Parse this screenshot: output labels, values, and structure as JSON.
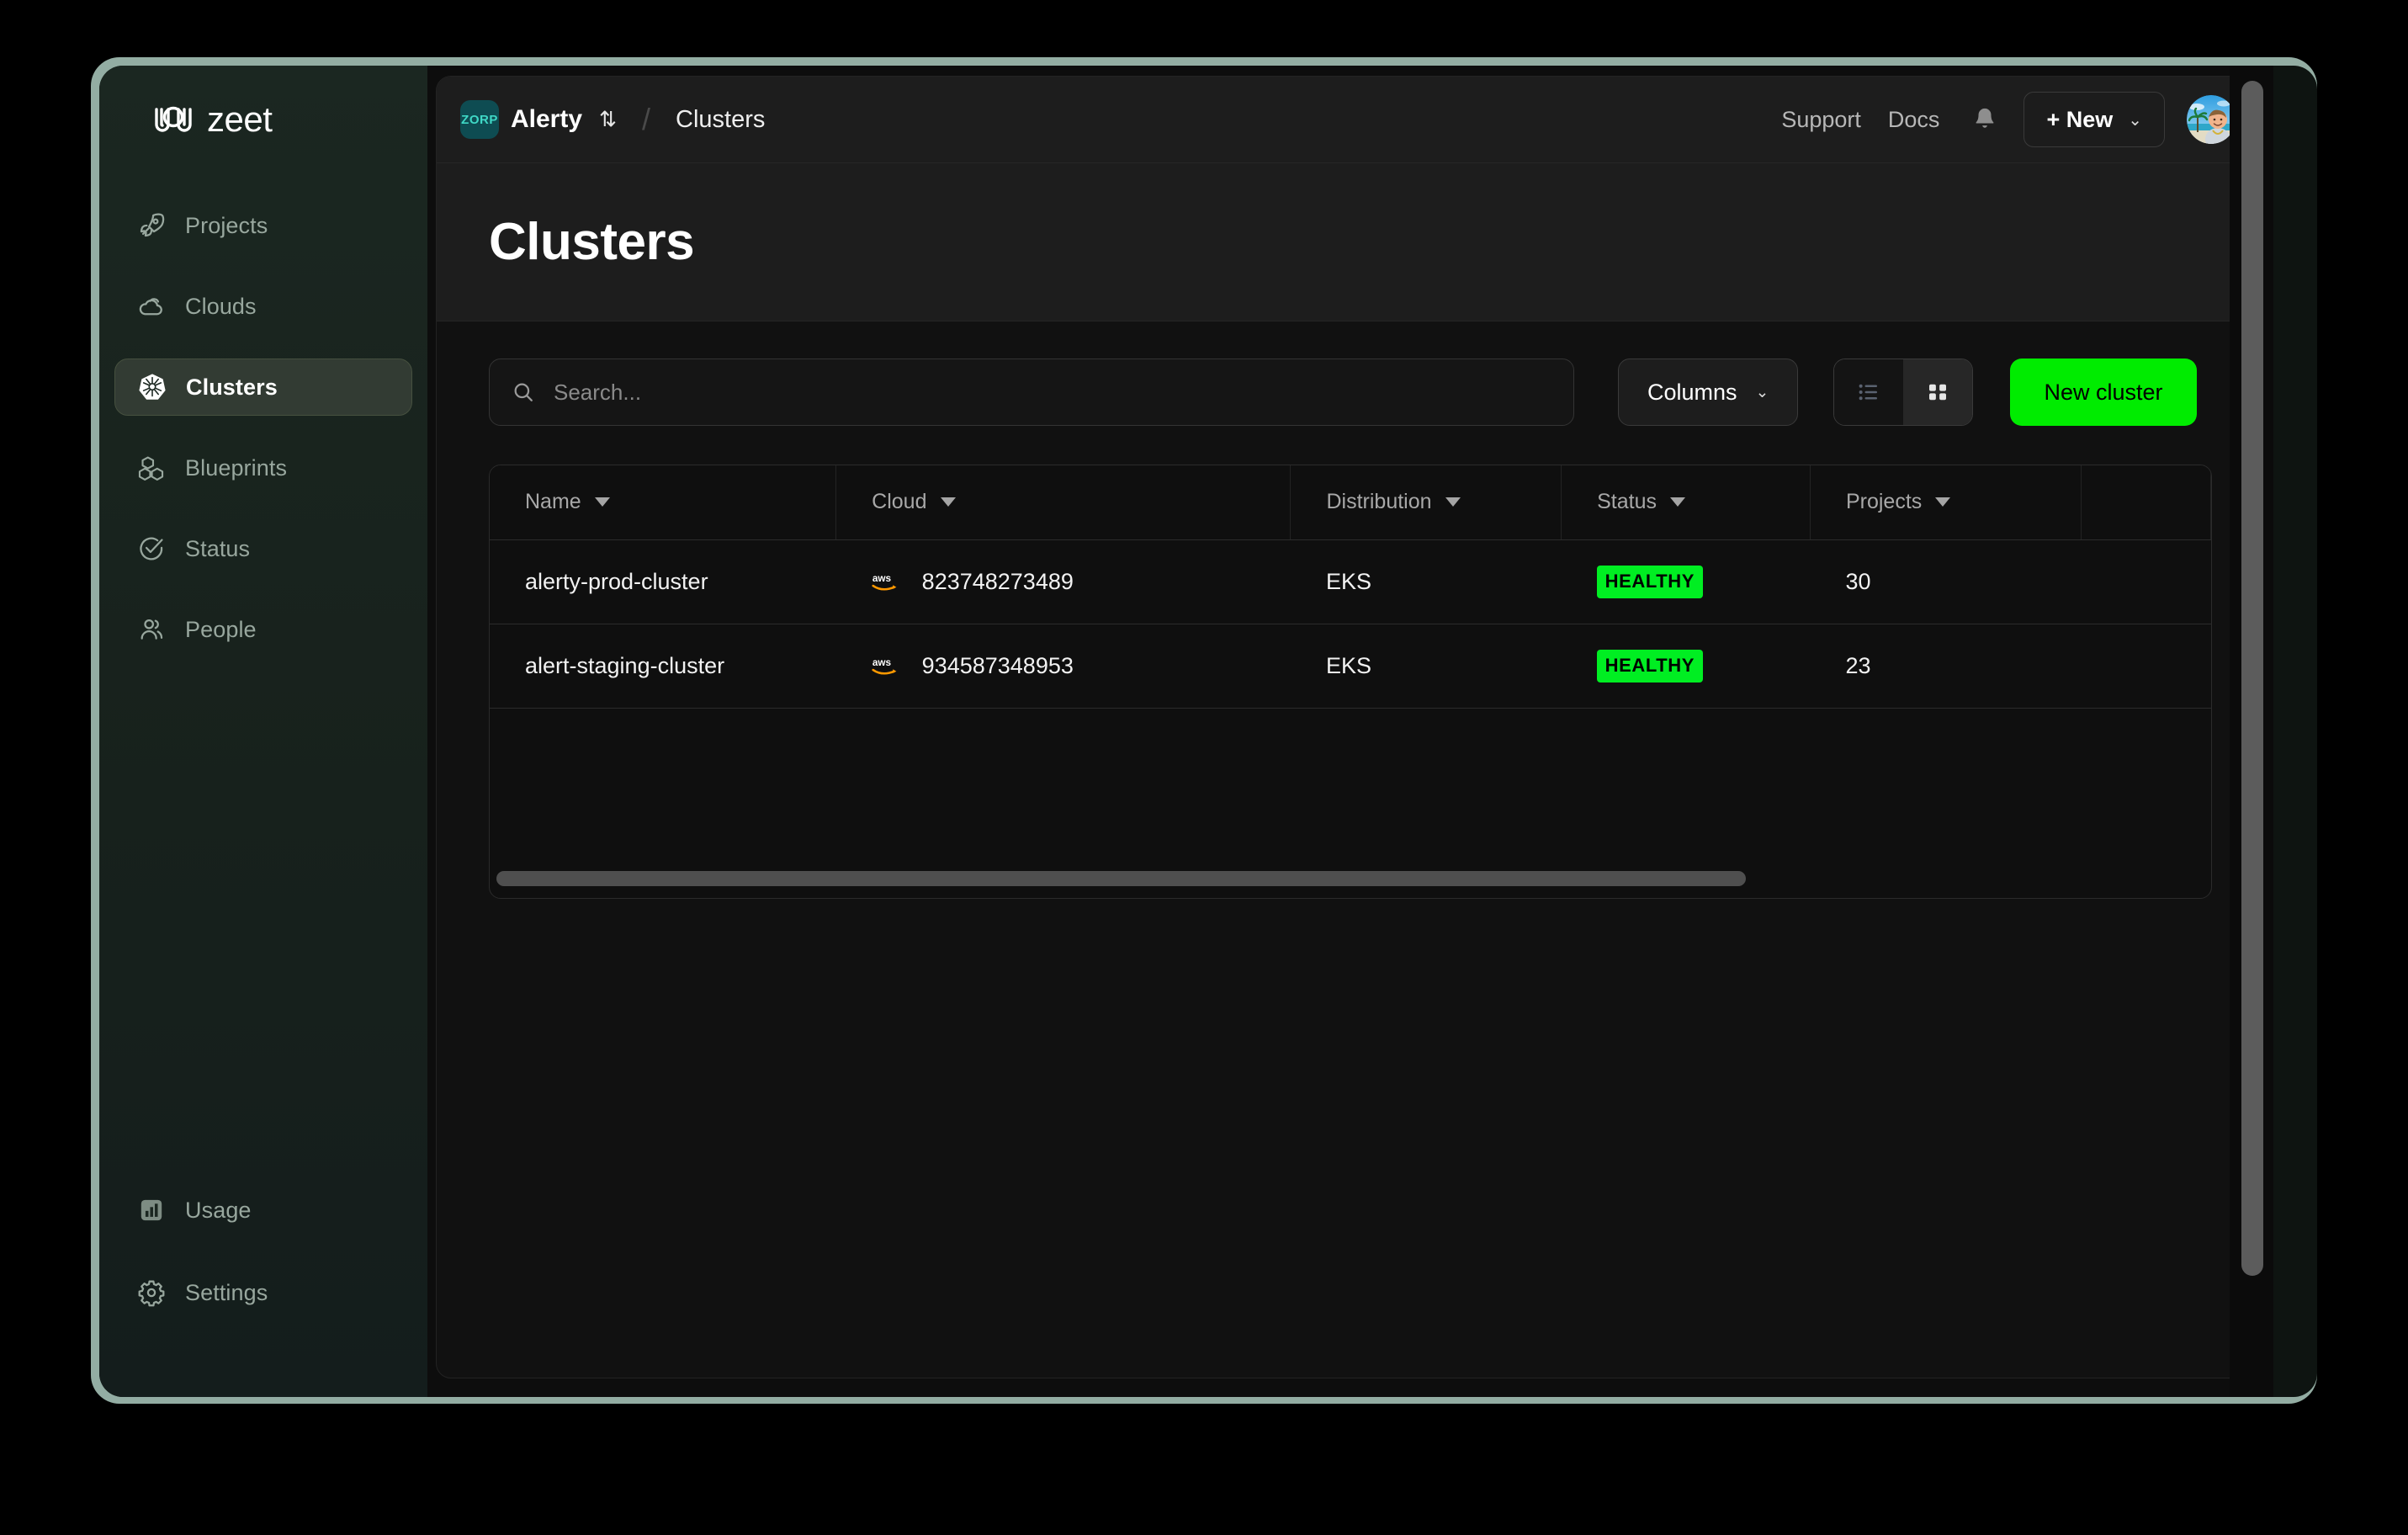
{
  "brand": {
    "name": "zeet",
    "logo_icon": "zeet-logo-icon"
  },
  "sidebar": {
    "main_items": [
      {
        "label": "Projects",
        "icon": "rocket-icon",
        "active": false
      },
      {
        "label": "Clouds",
        "icon": "cloud-icon",
        "active": false
      },
      {
        "label": "Clusters",
        "icon": "kubernetes-icon",
        "active": true
      },
      {
        "label": "Blueprints",
        "icon": "blocks-icon",
        "active": false
      },
      {
        "label": "Status",
        "icon": "check-circle-icon",
        "active": false
      },
      {
        "label": "People",
        "icon": "people-icon",
        "active": false
      }
    ],
    "bottom_items": [
      {
        "label": "Usage",
        "icon": "bar-chart-icon",
        "active": false
      },
      {
        "label": "Settings",
        "icon": "gear-icon",
        "active": false
      }
    ]
  },
  "topbar": {
    "org_logo_text": "ZORP",
    "org_name": "Alerty",
    "org_switch_icon": "chevron-up-down-icon",
    "breadcrumb_separator": "/",
    "breadcrumb_current": "Clusters",
    "support_label": "Support",
    "docs_label": "Docs",
    "bell_icon": "bell-icon",
    "new_button_label": "+ New",
    "new_button_caret": "chevron-down-icon",
    "avatar_icon": "user-avatar-photo"
  },
  "page": {
    "title": "Clusters"
  },
  "toolbar": {
    "search_placeholder": "Search...",
    "search_value": "",
    "search_icon": "search-icon",
    "columns_label": "Columns",
    "columns_caret_icon": "chevron-down-icon",
    "view_list_icon": "list-view-icon",
    "view_grid_icon": "grid-view-icon",
    "view_selected": "grid",
    "new_cluster_label": "New cluster"
  },
  "table": {
    "columns": [
      {
        "label": "Name",
        "sort_icon": "sort-caret-icon"
      },
      {
        "label": "Cloud",
        "sort_icon": "sort-caret-icon"
      },
      {
        "label": "Distribution",
        "sort_icon": "sort-caret-icon"
      },
      {
        "label": "Status",
        "sort_icon": "sort-caret-icon"
      },
      {
        "label": "Projects",
        "sort_icon": "sort-caret-icon"
      }
    ],
    "rows": [
      {
        "name": "alerty-prod-cluster",
        "cloud_icon": "aws-icon",
        "cloud_account": "823748273489",
        "distribution": "EKS",
        "status": "HEALTHY",
        "projects": "30"
      },
      {
        "name": "alert-staging-cluster",
        "cloud_icon": "aws-icon",
        "cloud_account": "934587348953",
        "distribution": "EKS",
        "status": "HEALTHY",
        "projects": "23"
      }
    ]
  },
  "colors": {
    "accent_green": "#00ec00",
    "status_healthy": "#00ee22",
    "frame_sage": "#93ada3",
    "sidebar_green": "#1b2721",
    "org_logo_bg": "#0e4c52",
    "org_logo_text": "#3fd8c6",
    "aws_orange": "#ff9900"
  }
}
